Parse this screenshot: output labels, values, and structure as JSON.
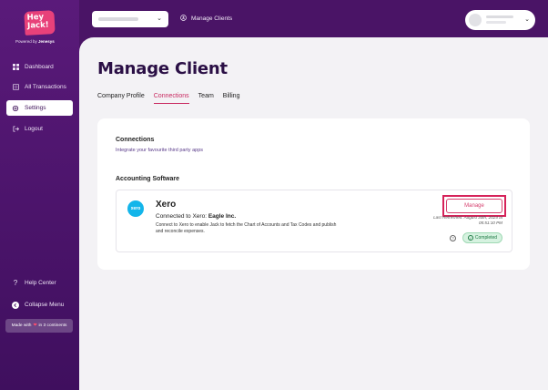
{
  "brand": {
    "logo_text": "Hey Jack!",
    "powered_prefix": "Powered by",
    "powered_brand": "Jenesys"
  },
  "sidebar": {
    "items": [
      {
        "label": "Dashboard",
        "icon": "dashboard-icon",
        "active": false
      },
      {
        "label": "All Transactions",
        "icon": "transactions-icon",
        "active": false
      },
      {
        "label": "Settings",
        "icon": "gear-icon",
        "active": true
      },
      {
        "label": "Logout",
        "icon": "logout-icon",
        "active": false
      }
    ],
    "help_label": "Help Center",
    "collapse_label": "Collapse Menu",
    "made_with_prefix": "Made with",
    "made_with_suffix": "in  3 continents"
  },
  "topbar": {
    "manage_clients_label": "Manage Clients"
  },
  "main": {
    "title": "Manage Client",
    "tabs": [
      {
        "label": "Company Profile",
        "active": false
      },
      {
        "label": "Connections",
        "active": true
      },
      {
        "label": "Team",
        "active": false
      },
      {
        "label": "Billing",
        "active": false
      }
    ],
    "connections": {
      "title": "Connections",
      "subtitle": "Integrate your favourite third party apps",
      "accounting_title": "Accounting Software",
      "integration": {
        "logo_text": "xero",
        "name": "Xero",
        "connected_prefix": "Connected to Xero:",
        "connected_company": "Eagle Inc.",
        "description": "Connect to Xero to enable Jack to fetch the Chart of Accounts and Tax Codes and publish and reconcile expenses.",
        "manage_label": "Manage",
        "last_refreshed_line1": "Last Refreshed: August 30th, 2024 at",
        "last_refreshed_line2": "05:51:10 PM",
        "status": "Completed"
      }
    }
  },
  "colors": {
    "sidebar": "#5a1a7a",
    "accent": "#c8285f",
    "status_green": "#1e7a44",
    "xero_blue": "#13b5ea"
  }
}
